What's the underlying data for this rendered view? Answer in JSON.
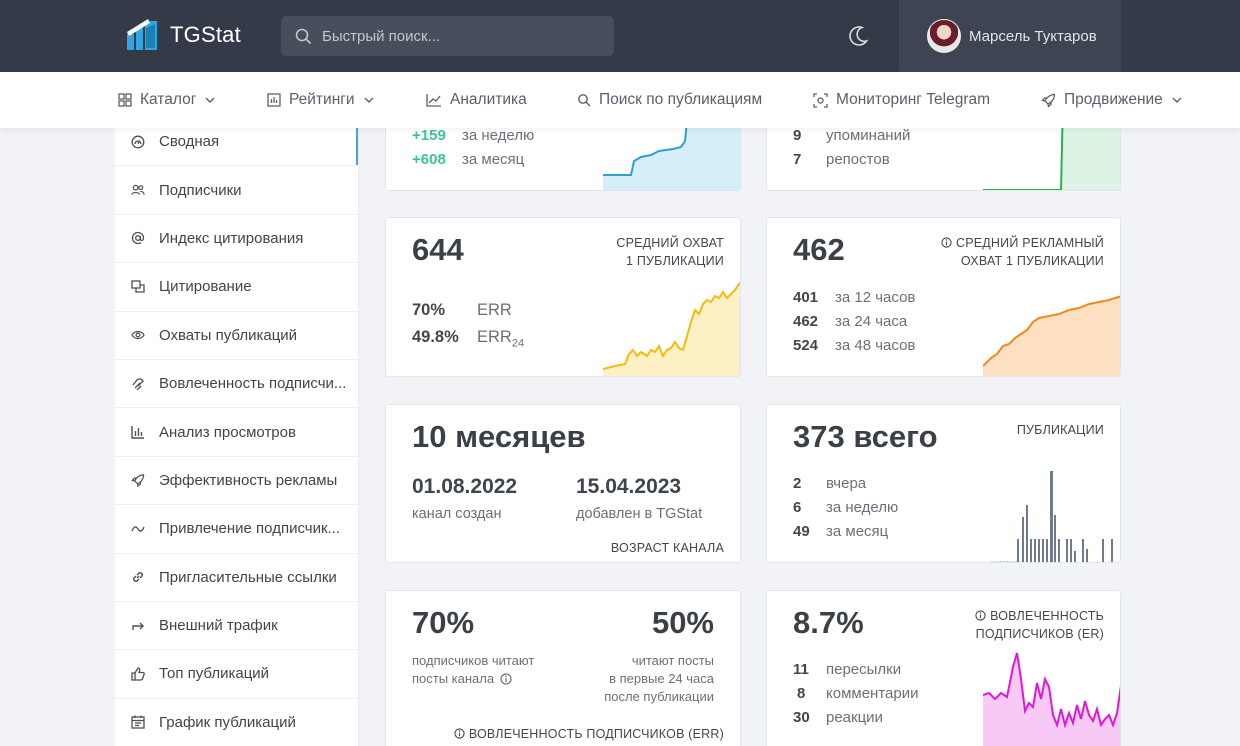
{
  "header": {
    "logo_text": "TGStat",
    "search_placeholder": "Быстрый поиск...",
    "user_name": "Марсель Туктаров"
  },
  "nav": [
    {
      "label": "Каталог",
      "icon": "grid-icon",
      "dropdown": true
    },
    {
      "label": "Рейтинги",
      "icon": "bar-chart-icon",
      "dropdown": true
    },
    {
      "label": "Аналитика",
      "icon": "line-chart-icon",
      "dropdown": false
    },
    {
      "label": "Поиск по публикациям",
      "icon": "search-icon",
      "dropdown": false
    },
    {
      "label": "Мониторинг Telegram",
      "icon": "monitor-icon",
      "dropdown": false
    },
    {
      "label": "Продвижение",
      "icon": "rocket-icon",
      "dropdown": true
    }
  ],
  "sidebar": [
    {
      "label": "Сводная",
      "icon": "dashboard-icon",
      "active": true
    },
    {
      "label": "Подписчики",
      "icon": "users-icon"
    },
    {
      "label": "Индекс цитирования",
      "icon": "at-icon"
    },
    {
      "label": "Цитирование",
      "icon": "quote-icon"
    },
    {
      "label": "Охваты публикаций",
      "icon": "eye-icon"
    },
    {
      "label": "Вовлеченность подписчи...",
      "icon": "engagement-icon"
    },
    {
      "label": "Анализ просмотров",
      "icon": "bar-chart-icon"
    },
    {
      "label": "Эффективность рекламы",
      "icon": "rocket-icon"
    },
    {
      "label": "Привлечение подписчик...",
      "icon": "trend-icon"
    },
    {
      "label": "Пригласительные ссылки",
      "icon": "link-icon"
    },
    {
      "label": "Внешний трафик",
      "icon": "external-arrow-icon"
    },
    {
      "label": "Топ публикаций",
      "icon": "thumbs-up-icon"
    },
    {
      "label": "График публикаций",
      "icon": "calendar-icon"
    }
  ],
  "cards": {
    "subs": {
      "rows": [
        {
          "value": "+159",
          "label": "за неделю"
        },
        {
          "value": "+608",
          "label": "за месяц"
        }
      ]
    },
    "mentions": {
      "rows": [
        {
          "value": "9",
          "label": "упоминаний"
        },
        {
          "value": "7",
          "label": "репостов"
        }
      ]
    },
    "reach": {
      "value": "644",
      "caption_1": "СРЕДНИЙ ОХВАТ",
      "caption_2": "1 ПУБЛИКАЦИИ",
      "err_value": "70%",
      "err_label": "ERR",
      "err24_value": "49.8%",
      "err24_label": "ERR",
      "err24_sub": "24"
    },
    "ad_reach": {
      "value": "462",
      "caption_1": "СРЕДНИЙ РЕКЛАМНЫЙ",
      "caption_2": "ОХВАТ 1 ПУБЛИКАЦИИ",
      "rows": [
        {
          "value": "401",
          "label": "за 12 часов"
        },
        {
          "value": "462",
          "label": "за 24 часа"
        },
        {
          "value": "524",
          "label": "за 48 часов"
        }
      ]
    },
    "age": {
      "value": "10 месяцев",
      "created_date": "01.08.2022",
      "created_label": "канал создан",
      "added_date": "15.04.2023",
      "added_label": "добавлен в TGStat",
      "caption": "ВОЗРАСТ КАНАЛА"
    },
    "posts": {
      "value": "373 всего",
      "caption": "ПУБЛИКАЦИИ",
      "rows": [
        {
          "value": "2",
          "label": "вчера"
        },
        {
          "value": "6",
          "label": "за неделю"
        },
        {
          "value": "49",
          "label": "за месяц"
        }
      ]
    },
    "err": {
      "value_left": "70%",
      "label_left_1": "подписчиков читают",
      "label_left_2": "посты канала",
      "value_right": "50%",
      "label_right_1": "читают посты",
      "label_right_2": "в первые 24 часа",
      "label_right_3": "после публикации",
      "caption": "ВОВЛЕЧЕННОСТЬ ПОДПИСЧИКОВ (ERR)"
    },
    "er": {
      "value": "8.7%",
      "caption_1": "ВОВЛЕЧЕННОСТЬ",
      "caption_2": "ПОДПИСЧИКОВ (ER)",
      "rows": [
        {
          "value": "11",
          "label": "пересылки"
        },
        {
          "value": "8",
          "label": "комментарии"
        },
        {
          "value": "30",
          "label": "реакции"
        }
      ]
    }
  },
  "colors": {
    "topbar": "#343a47",
    "accent_blue": "#4aa3df",
    "green": "#3cc39a",
    "yellow": "#f5c518",
    "orange": "#f19a3a",
    "magenta": "#e21ee0",
    "bar_gray": "#6f7b8a"
  }
}
